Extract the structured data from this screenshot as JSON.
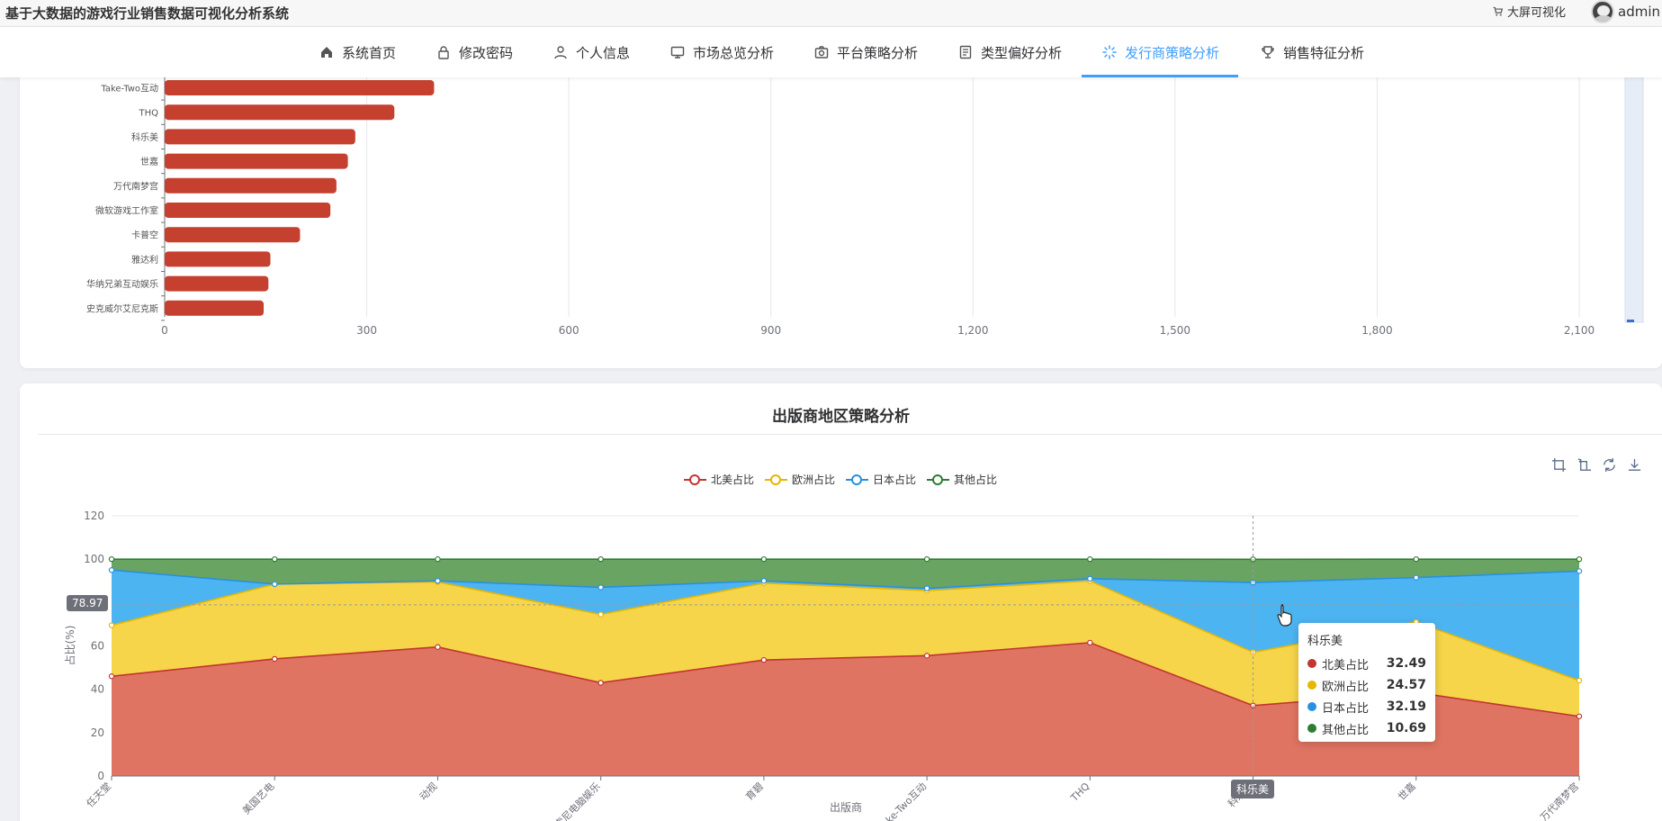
{
  "header": {
    "app_title": "基于大数据的游戏行业销售数据可视化分析系统",
    "big_screen_label": "大屏可视化",
    "username": "admin"
  },
  "nav": {
    "items": [
      {
        "label": "系统首页",
        "icon": "home-icon"
      },
      {
        "label": "修改密码",
        "icon": "lock-icon"
      },
      {
        "label": "个人信息",
        "icon": "user-icon"
      },
      {
        "label": "市场总览分析",
        "icon": "monitor-icon"
      },
      {
        "label": "平台策略分析",
        "icon": "camera-icon"
      },
      {
        "label": "类型偏好分析",
        "icon": "document-icon"
      },
      {
        "label": "发行商策略分析",
        "icon": "loading-icon"
      },
      {
        "label": "销售特征分析",
        "icon": "trophy-icon"
      }
    ],
    "active_index": 6
  },
  "colors": {
    "accent": "#409eff",
    "bar": "#c64030",
    "north_america": "#c23531",
    "europe": "#e6b600",
    "japan": "#2890e0",
    "other": "#2d7d32"
  },
  "chart_data": [
    {
      "type": "bar",
      "orientation": "horizontal",
      "categories": [
        "Take-Two互动",
        "THQ",
        "科乐美",
        "世嘉",
        "万代南梦宫",
        "微软游戏工作室",
        "卡普空",
        "雅达利",
        "华纳兄弟互动娱乐",
        "史克威尔艾尼克斯"
      ],
      "values": [
        400,
        341,
        283,
        272,
        255,
        246,
        201,
        157,
        154,
        147
      ],
      "xlim": [
        0,
        2100
      ],
      "xticks": [
        "0",
        "300",
        "600",
        "900",
        "1,200",
        "1,500",
        "1,800",
        "2,100"
      ],
      "grid": true
    },
    {
      "type": "area",
      "stacked": true,
      "title": "出版商地区策略分析",
      "xlabel": "出版商",
      "ylabel": "占比(%)",
      "ylim": [
        0,
        120
      ],
      "yticks": [
        0,
        20,
        40,
        60,
        80,
        100,
        120
      ],
      "categories": [
        "任天堂",
        "美国艺电",
        "动视",
        "索尼电脑娱乐",
        "育碧",
        "Take-Two互动",
        "THQ",
        "科乐美",
        "世嘉",
        "万代南梦宫"
      ],
      "series": [
        {
          "name": "北美占比",
          "values": [
            46,
            54,
            59.5,
            43,
            53.5,
            55.5,
            61.5,
            32.49,
            38.5,
            27.5
          ]
        },
        {
          "name": "欧洲占比",
          "values": [
            23.5,
            34.5,
            30,
            31.5,
            35.5,
            30,
            28.5,
            24.57,
            32.5,
            16.5
          ]
        },
        {
          "name": "日本占比",
          "values": [
            25.5,
            0,
            0.5,
            12.5,
            1,
            1,
            1,
            32.19,
            20.5,
            50.5
          ]
        },
        {
          "name": "其他占比",
          "values": [
            5,
            11.5,
            10,
            13,
            10,
            13.5,
            9,
            10.69,
            8.5,
            5.5
          ]
        }
      ],
      "legend_position": "top-center",
      "axis_pointer": {
        "y_value": "78.97",
        "x_category": "科乐美"
      },
      "tooltip": {
        "title": "科乐美",
        "rows": [
          {
            "name": "北美占比",
            "value": "32.49"
          },
          {
            "name": "欧洲占比",
            "value": "24.57"
          },
          {
            "name": "日本占比",
            "value": "32.19"
          },
          {
            "name": "其他占比",
            "value": "10.69"
          }
        ]
      }
    }
  ]
}
